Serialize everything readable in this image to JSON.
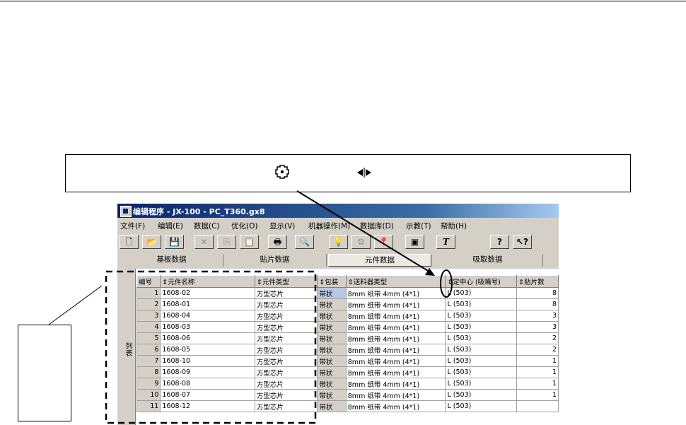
{
  "window": {
    "title": "编辑程序 - JX-100 - PC_T360.gx8"
  },
  "menu": [
    "文件(F)",
    "编辑(E)",
    "数据(C)",
    "优化(O)",
    "显示(V)",
    "机器操作(M)",
    "数据库(D)",
    "示教(T)",
    "帮助(H)"
  ],
  "toolbar": {
    "new": "🗋",
    "open": "📂",
    "save": "💾",
    "delete": "✕",
    "copy": "⎘",
    "paste": "📋",
    "print": "🖶",
    "find": "🔍",
    "bulb": "💡",
    "robot": "⚙",
    "pin": "📍",
    "chip": "▣",
    "text": "T",
    "help": "?",
    "whatsthis": "↖?"
  },
  "tabs": [
    "基板数据",
    "贴片数据",
    "元件数据",
    "吸取数据"
  ],
  "active_tab": "元件数据",
  "grid": {
    "side_label": "列表",
    "columns": [
      "编号",
      "⇕元件名称",
      "⇕元件类型",
      "⇕包装",
      "⇕送料器类型",
      "⇕定中心 (吸嘴号)",
      "⇕贴片数"
    ],
    "rows": [
      {
        "no": "1",
        "name": "1608-02",
        "type": "方型芯片",
        "pack": "带状",
        "feeder": "8mm 纸带   4mm (4*1)",
        "center": "L (503)",
        "count": "8"
      },
      {
        "no": "2",
        "name": "1608-01",
        "type": "方型芯片",
        "pack": "带状",
        "feeder": "8mm 纸带   4mm (4*1)",
        "center": "L (503)",
        "count": "8"
      },
      {
        "no": "3",
        "name": "1608-04",
        "type": "方型芯片",
        "pack": "带状",
        "feeder": "8mm 纸带   4mm (4*1)",
        "center": "L (503)",
        "count": "3"
      },
      {
        "no": "4",
        "name": "1608-03",
        "type": "方型芯片",
        "pack": "带状",
        "feeder": "8mm 纸带   4mm (4*1)",
        "center": "L (503)",
        "count": "3"
      },
      {
        "no": "5",
        "name": "1608-06",
        "type": "方型芯片",
        "pack": "带状",
        "feeder": "8mm 纸带   4mm (4*1)",
        "center": "L (503)",
        "count": "2"
      },
      {
        "no": "6",
        "name": "1608-05",
        "type": "方型芯片",
        "pack": "带状",
        "feeder": "8mm 纸带   4mm (4*1)",
        "center": "L (503)",
        "count": "2"
      },
      {
        "no": "7",
        "name": "1608-10",
        "type": "方型芯片",
        "pack": "带状",
        "feeder": "8mm 纸带   4mm (4*1)",
        "center": "L (503)",
        "count": "1"
      },
      {
        "no": "8",
        "name": "1608-09",
        "type": "方型芯片",
        "pack": "带状",
        "feeder": "8mm 纸带   4mm (4*1)",
        "center": "L (503)",
        "count": "1"
      },
      {
        "no": "9",
        "name": "1608-08",
        "type": "方型芯片",
        "pack": "带状",
        "feeder": "8mm 纸带   4mm (4*1)",
        "center": "L (503)",
        "count": "1"
      },
      {
        "no": "10",
        "name": "1608-07",
        "type": "方型芯片",
        "pack": "带状",
        "feeder": "8mm 纸带   4mm (4*1)",
        "center": "L (503)",
        "count": "1"
      },
      {
        "no": "11",
        "name": "1608-12",
        "type": "方型芯片",
        "pack": "带状",
        "feeder": "8mm 纸带   4mm (4*1)",
        "center": "L (503)",
        "count": ""
      }
    ]
  },
  "colors": {
    "title_start": "#0a246a",
    "title_end": "#a6caf0",
    "face": "#d4d0c8",
    "selected_cell": "#b8c8e0"
  },
  "callout_icons": [
    "center-target-icon",
    "column-resize-icon"
  ]
}
